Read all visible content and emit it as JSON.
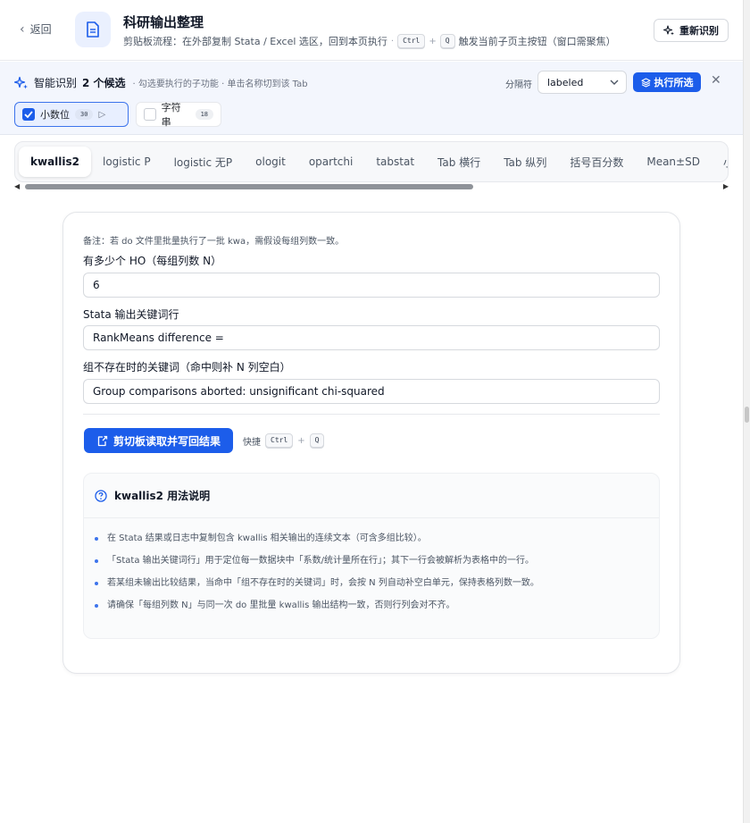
{
  "header": {
    "back_label": "返回",
    "title": "科研输出整理",
    "subtitle_text": "剪贴板流程：在外部复制 Stata / Excel 选区，回到本页执行",
    "shortcut_keys": [
      "Ctrl",
      "Q"
    ],
    "subtitle_suffix": "触发当前子页主按钮（窗口需聚焦）",
    "reidentify_label": "重新识别",
    "app_icon": "document-icon"
  },
  "smart": {
    "title_prefix": "智能识别",
    "title_count": "2 个候选",
    "hint": "· 勾选要执行的子功能 · 单击名称切到该 Tab",
    "separator_label": "分隔符",
    "separator_value": "labeled",
    "run_label": "执行所选",
    "chips": [
      {
        "label": "小数位",
        "count": "30",
        "checked": true
      },
      {
        "label": "字符串",
        "count": "18",
        "checked": false
      }
    ]
  },
  "tabs": [
    "kwallis2",
    "logistic P",
    "logistic 无P",
    "ologit",
    "opartchi",
    "tabstat",
    "Tab 横行",
    "Tab 纵列",
    "括号百分数",
    "Mean±SD",
    "小数位"
  ],
  "active_tab": "kwallis2",
  "form": {
    "note": "备注：若 do 文件里批量执行了一批 kwa，需假设每组列数一致。",
    "field1_label": "有多少个 HO（每组列数 N）",
    "field1_value": "6",
    "field2_label": "Stata 输出关键词行",
    "field2_value": "RankMeans difference =",
    "field3_label": "组不存在时的关键词（命中则补 N 列空白）",
    "field3_value": "Group comparisons aborted: unsignificant chi-squared",
    "primary_label": "剪切板读取并写回结果",
    "shortcut_label": "快捷",
    "shortcut_keys": [
      "Ctrl",
      "Q"
    ]
  },
  "help": {
    "title": "kwallis2 用法说明",
    "items": [
      "在 Stata 结果或日志中复制包含 kwallis 相关输出的连续文本（可含多组比较）。",
      "「Stata 输出关键词行」用于定位每一数据块中「系数/统计量所在行」；其下一行会被解析为表格中的一行。",
      "若某组未输出比较结果，当命中「组不存在时的关键词」时，会按 N 列自动补空白单元，保持表格列数一致。",
      "请确保「每组列数 N」与同一次 do 里批量 kwallis 输出结构一致，否则行列会对不齐。"
    ]
  },
  "colors": {
    "primary": "#1c5dea",
    "smart_bg": "#f3f6fd",
    "app_icon_bg": "#eaf0fe"
  }
}
